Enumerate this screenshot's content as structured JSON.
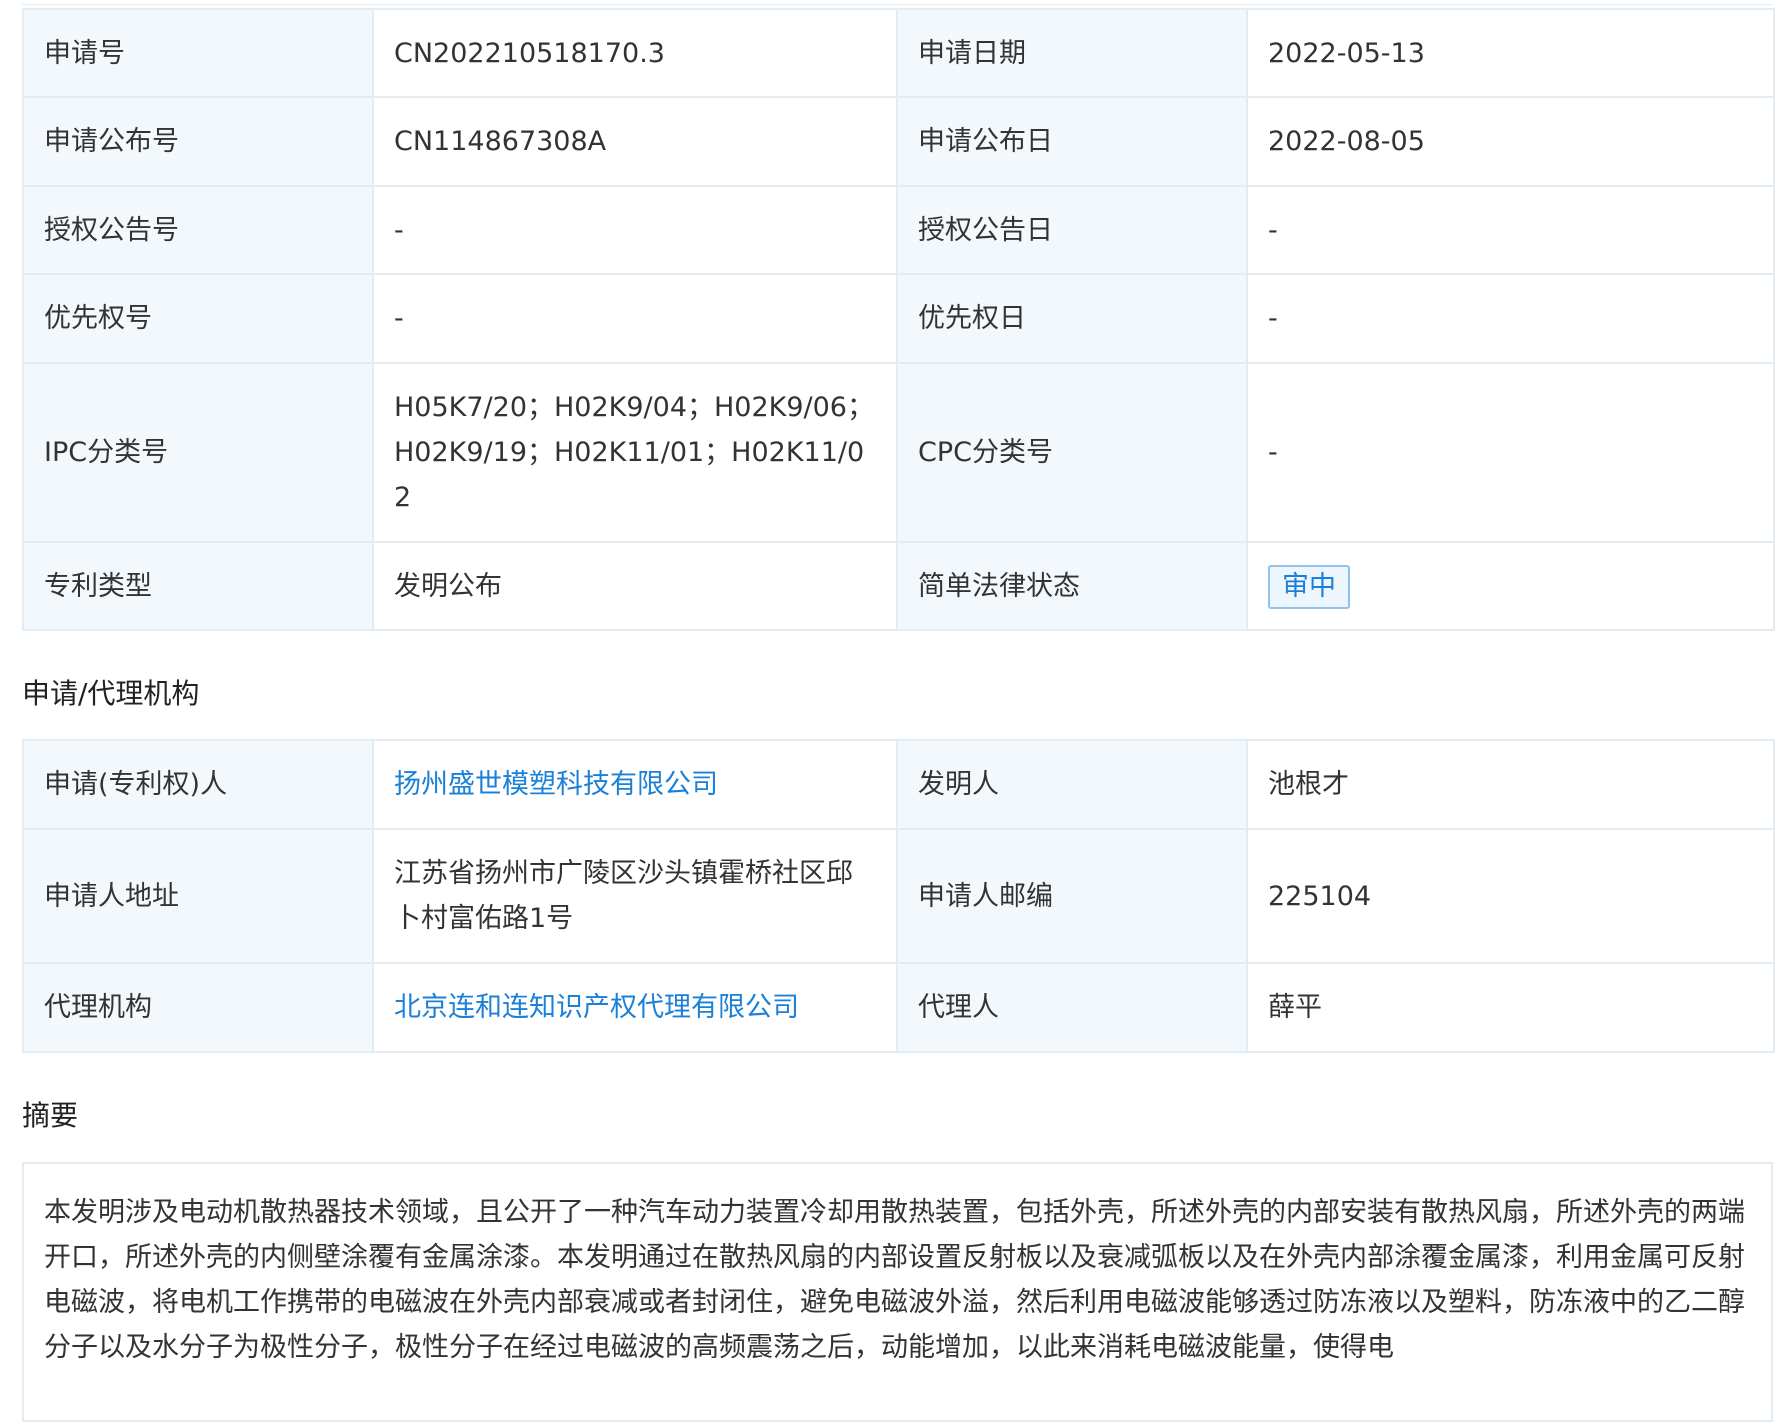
{
  "basic_info": {
    "rows": [
      {
        "k1": "申请号",
        "v1": "CN202210518170.3",
        "k2": "申请日期",
        "v2": "2022-05-13"
      },
      {
        "k1": "申请公布号",
        "v1": "CN114867308A",
        "k2": "申请公布日",
        "v2": "2022-08-05"
      },
      {
        "k1": "授权公告号",
        "v1": "-",
        "k2": "授权公告日",
        "v2": "-"
      },
      {
        "k1": "优先权号",
        "v1": "-",
        "k2": "优先权日",
        "v2": "-"
      },
      {
        "k1": "IPC分类号",
        "v1": "H05K7/20；H02K9/04；H02K9/06；H02K9/19；H02K11/01；H02K11/02",
        "k2": "CPC分类号",
        "v2": "-"
      },
      {
        "k1": "专利类型",
        "v1": "发明公布",
        "k2": "简单法律状态",
        "v2": "审中"
      }
    ]
  },
  "agency": {
    "title": "申请/代理机构",
    "rows": [
      {
        "k1": "申请(专利权)人",
        "v1": "扬州盛世模塑科技有限公司",
        "k2": "发明人",
        "v2": "池根才"
      },
      {
        "k1": "申请人地址",
        "v1": "江苏省扬州市广陵区沙头镇霍桥社区邱卜村富佑路1号",
        "k2": "申请人邮编",
        "v2": "225104"
      },
      {
        "k1": "代理机构",
        "v1": "北京连和连知识产权代理有限公司",
        "k2": "代理人",
        "v2": "薛平"
      }
    ]
  },
  "abstract": {
    "title": "摘要",
    "text": "本发明涉及电动机散热器技术领域，且公开了一种汽车动力装置冷却用散热装置，包括外壳，所述外壳的内部安装有散热风扇，所述外壳的两端开口，所述外壳的内侧壁涂覆有金属涂漆。本发明通过在散热风扇的内部设置反射板以及衰减弧板以及在外壳内部涂覆金属漆，利用金属可反射电磁波，将电机工作携带的电磁波在外壳内部衰减或者封闭住，避免电磁波外溢，然后利用电磁波能够透过防冻液以及塑料，防冻液中的乙二醇分子以及水分子为极性分子，极性分子在经过电磁波的高频震荡之后，动能增加，以此来消耗电磁波能量，使得电"
  },
  "colors": {
    "link": "#1b80d8",
    "key_cell_bg": "#f3f8fc",
    "border": "#e4ecf3",
    "badge_border": "#8fc3ee"
  }
}
